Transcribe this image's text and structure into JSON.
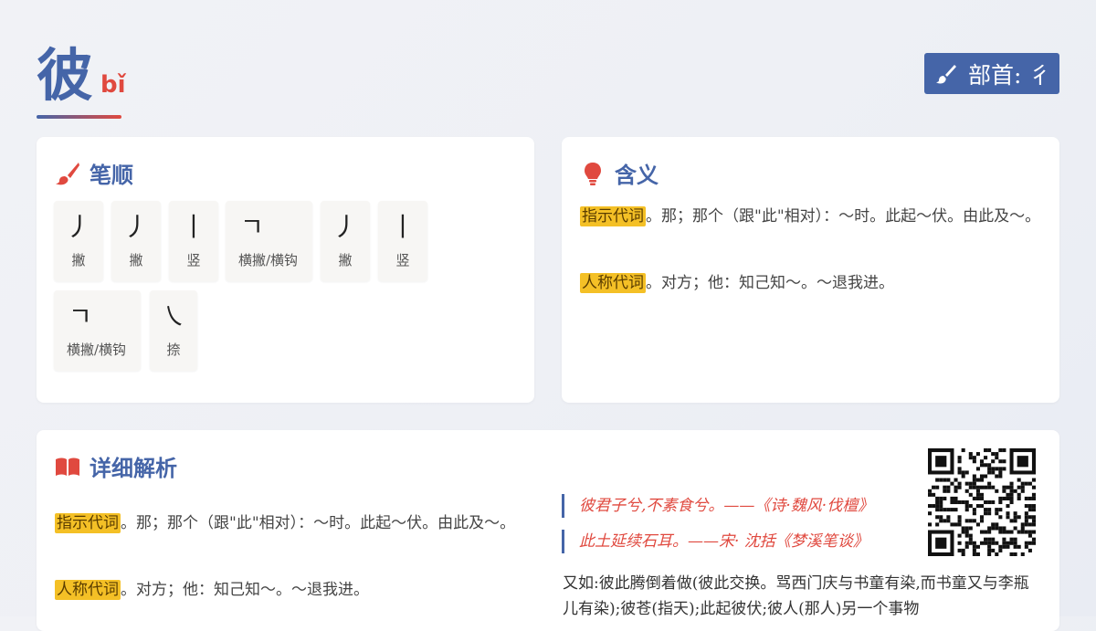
{
  "header": {
    "character": "彼",
    "pinyin": "bǐ",
    "radical_label": "部首: 彳"
  },
  "stroke_section": {
    "title": "笔顺",
    "strokes": [
      {
        "glyph": "丿",
        "name": "撇"
      },
      {
        "glyph": "丿",
        "name": "撇"
      },
      {
        "glyph": "丨",
        "name": "竖"
      },
      {
        "glyph": "ㄱ",
        "name": "横撇/横钩"
      },
      {
        "glyph": "丿",
        "name": "撇"
      },
      {
        "glyph": "丨",
        "name": "竖"
      },
      {
        "glyph": "ㄱ",
        "name": "横撇/横钩"
      },
      {
        "glyph": "㇏",
        "name": "捺"
      }
    ]
  },
  "meaning_section": {
    "title": "含义",
    "items": [
      {
        "tag": "指示代词",
        "text": "。那；那个（跟\"此\"相对）：～时。此起～伏。由此及～。"
      },
      {
        "tag": "人称代词",
        "text": "。对方；他：知己知～。～退我进。"
      }
    ]
  },
  "detail_section": {
    "title": "详细解析",
    "items": [
      {
        "tag": "指示代词",
        "text": "。那；那个（跟\"此\"相对）：～时。此起～伏。由此及～。"
      },
      {
        "tag": "人称代词",
        "text": "。对方；他：知己知～。～退我进。"
      }
    ],
    "quotes": [
      "彼君子兮,不素食兮。——《诗·魏风·伐檀》",
      "此土延续石耳。——宋· 沈括《梦溪笔谈》"
    ],
    "example": "又如:彼此腾倒着做(彼此交换。骂西门庆与书童有染,而书童又与李瓶儿有染);彼苍(指天);此起彼伏;彼人(那人)另一个事物"
  },
  "colors": {
    "primary": "#4565a8",
    "accent": "#e0493f",
    "highlight": "#f4c026"
  },
  "icons": {
    "radical": "brush-icon",
    "stroke": "paintbrush-icon",
    "meaning": "lightbulb-icon",
    "detail": "book-icon",
    "qr": "qr-code"
  }
}
